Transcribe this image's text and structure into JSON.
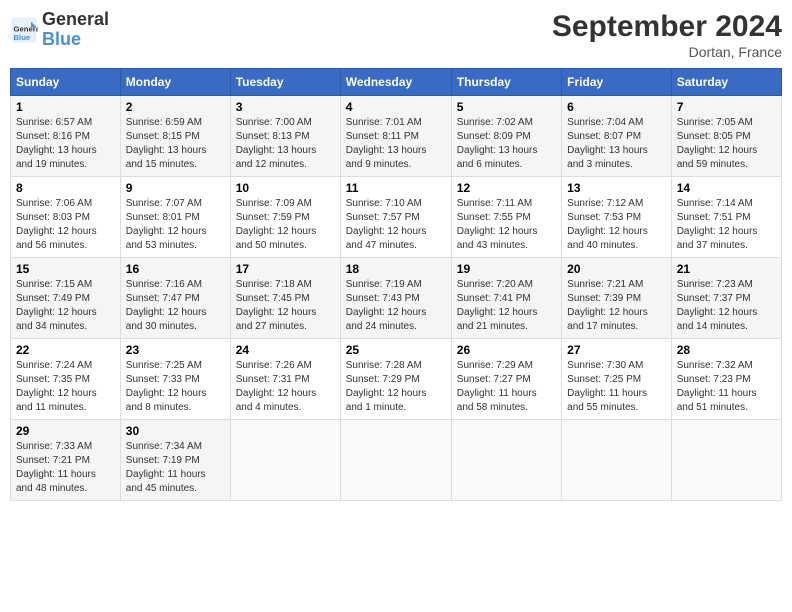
{
  "header": {
    "logo_line1": "General",
    "logo_line2": "Blue",
    "month": "September 2024",
    "location": "Dortan, France"
  },
  "days_of_week": [
    "Sunday",
    "Monday",
    "Tuesday",
    "Wednesday",
    "Thursday",
    "Friday",
    "Saturday"
  ],
  "weeks": [
    [
      {
        "day": "1",
        "info": "Sunrise: 6:57 AM\nSunset: 8:16 PM\nDaylight: 13 hours\nand 19 minutes."
      },
      {
        "day": "2",
        "info": "Sunrise: 6:59 AM\nSunset: 8:15 PM\nDaylight: 13 hours\nand 15 minutes."
      },
      {
        "day": "3",
        "info": "Sunrise: 7:00 AM\nSunset: 8:13 PM\nDaylight: 13 hours\nand 12 minutes."
      },
      {
        "day": "4",
        "info": "Sunrise: 7:01 AM\nSunset: 8:11 PM\nDaylight: 13 hours\nand 9 minutes."
      },
      {
        "day": "5",
        "info": "Sunrise: 7:02 AM\nSunset: 8:09 PM\nDaylight: 13 hours\nand 6 minutes."
      },
      {
        "day": "6",
        "info": "Sunrise: 7:04 AM\nSunset: 8:07 PM\nDaylight: 13 hours\nand 3 minutes."
      },
      {
        "day": "7",
        "info": "Sunrise: 7:05 AM\nSunset: 8:05 PM\nDaylight: 12 hours\nand 59 minutes."
      }
    ],
    [
      {
        "day": "8",
        "info": "Sunrise: 7:06 AM\nSunset: 8:03 PM\nDaylight: 12 hours\nand 56 minutes."
      },
      {
        "day": "9",
        "info": "Sunrise: 7:07 AM\nSunset: 8:01 PM\nDaylight: 12 hours\nand 53 minutes."
      },
      {
        "day": "10",
        "info": "Sunrise: 7:09 AM\nSunset: 7:59 PM\nDaylight: 12 hours\nand 50 minutes."
      },
      {
        "day": "11",
        "info": "Sunrise: 7:10 AM\nSunset: 7:57 PM\nDaylight: 12 hours\nand 47 minutes."
      },
      {
        "day": "12",
        "info": "Sunrise: 7:11 AM\nSunset: 7:55 PM\nDaylight: 12 hours\nand 43 minutes."
      },
      {
        "day": "13",
        "info": "Sunrise: 7:12 AM\nSunset: 7:53 PM\nDaylight: 12 hours\nand 40 minutes."
      },
      {
        "day": "14",
        "info": "Sunrise: 7:14 AM\nSunset: 7:51 PM\nDaylight: 12 hours\nand 37 minutes."
      }
    ],
    [
      {
        "day": "15",
        "info": "Sunrise: 7:15 AM\nSunset: 7:49 PM\nDaylight: 12 hours\nand 34 minutes."
      },
      {
        "day": "16",
        "info": "Sunrise: 7:16 AM\nSunset: 7:47 PM\nDaylight: 12 hours\nand 30 minutes."
      },
      {
        "day": "17",
        "info": "Sunrise: 7:18 AM\nSunset: 7:45 PM\nDaylight: 12 hours\nand 27 minutes."
      },
      {
        "day": "18",
        "info": "Sunrise: 7:19 AM\nSunset: 7:43 PM\nDaylight: 12 hours\nand 24 minutes."
      },
      {
        "day": "19",
        "info": "Sunrise: 7:20 AM\nSunset: 7:41 PM\nDaylight: 12 hours\nand 21 minutes."
      },
      {
        "day": "20",
        "info": "Sunrise: 7:21 AM\nSunset: 7:39 PM\nDaylight: 12 hours\nand 17 minutes."
      },
      {
        "day": "21",
        "info": "Sunrise: 7:23 AM\nSunset: 7:37 PM\nDaylight: 12 hours\nand 14 minutes."
      }
    ],
    [
      {
        "day": "22",
        "info": "Sunrise: 7:24 AM\nSunset: 7:35 PM\nDaylight: 12 hours\nand 11 minutes."
      },
      {
        "day": "23",
        "info": "Sunrise: 7:25 AM\nSunset: 7:33 PM\nDaylight: 12 hours\nand 8 minutes."
      },
      {
        "day": "24",
        "info": "Sunrise: 7:26 AM\nSunset: 7:31 PM\nDaylight: 12 hours\nand 4 minutes."
      },
      {
        "day": "25",
        "info": "Sunrise: 7:28 AM\nSunset: 7:29 PM\nDaylight: 12 hours\nand 1 minute."
      },
      {
        "day": "26",
        "info": "Sunrise: 7:29 AM\nSunset: 7:27 PM\nDaylight: 11 hours\nand 58 minutes."
      },
      {
        "day": "27",
        "info": "Sunrise: 7:30 AM\nSunset: 7:25 PM\nDaylight: 11 hours\nand 55 minutes."
      },
      {
        "day": "28",
        "info": "Sunrise: 7:32 AM\nSunset: 7:23 PM\nDaylight: 11 hours\nand 51 minutes."
      }
    ],
    [
      {
        "day": "29",
        "info": "Sunrise: 7:33 AM\nSunset: 7:21 PM\nDaylight: 11 hours\nand 48 minutes."
      },
      {
        "day": "30",
        "info": "Sunrise: 7:34 AM\nSunset: 7:19 PM\nDaylight: 11 hours\nand 45 minutes."
      },
      {
        "day": "",
        "info": ""
      },
      {
        "day": "",
        "info": ""
      },
      {
        "day": "",
        "info": ""
      },
      {
        "day": "",
        "info": ""
      },
      {
        "day": "",
        "info": ""
      }
    ]
  ]
}
